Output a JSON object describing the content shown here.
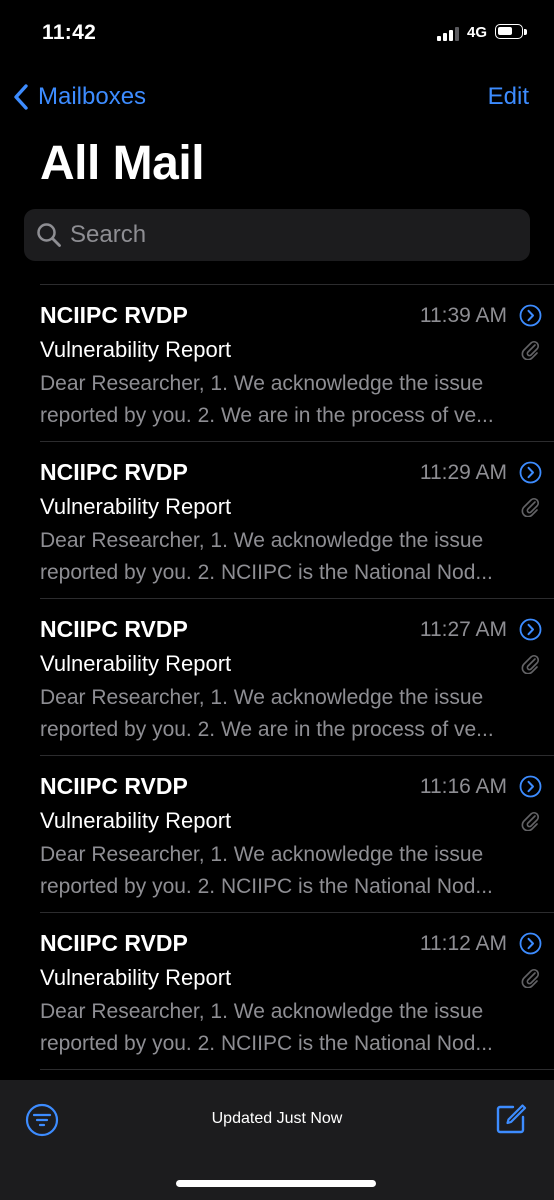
{
  "status_bar": {
    "time": "11:42",
    "network": "4G",
    "signal_icon": "signal-bars-icon",
    "battery_icon": "battery-icon",
    "battery_level": 0.5
  },
  "nav": {
    "back_label": "Mailboxes",
    "back_icon": "chevron-left-icon",
    "edit_label": "Edit"
  },
  "title": "All Mail",
  "search": {
    "placeholder": "Search",
    "value": "",
    "icon": "search-icon"
  },
  "emails": [
    {
      "sender": "NCIIPC RVDP",
      "time": "11:39 AM",
      "subject": "Vulnerability Report",
      "preview_line1": "Dear Researcher, 1. We acknowledge the issue",
      "preview_line2": "reported by you. 2. We are in the process of ve...",
      "has_attachment": true
    },
    {
      "sender": "NCIIPC RVDP",
      "time": "11:29 AM",
      "subject": "Vulnerability Report",
      "preview_line1": "Dear Researcher, 1. We acknowledge the issue",
      "preview_line2": "reported by you. 2. NCIIPC is the National Nod...",
      "has_attachment": true
    },
    {
      "sender": "NCIIPC RVDP",
      "time": "11:27 AM",
      "subject": "Vulnerability Report",
      "preview_line1": "Dear Researcher, 1. We acknowledge the issue",
      "preview_line2": "reported by you. 2. We are in the process of ve...",
      "has_attachment": true
    },
    {
      "sender": "NCIIPC RVDP",
      "time": "11:16 AM",
      "subject": "Vulnerability Report",
      "preview_line1": "Dear Researcher, 1. We acknowledge the issue",
      "preview_line2": "reported by you. 2. NCIIPC is the National Nod...",
      "has_attachment": true
    },
    {
      "sender": "NCIIPC RVDP",
      "time": "11:12 AM",
      "subject": "Vulnerability Report",
      "preview_line1": "Dear Researcher, 1. We acknowledge the issue",
      "preview_line2": "reported by you. 2. NCIIPC is the National Nod...",
      "has_attachment": true
    }
  ],
  "toolbar": {
    "status": "Updated Just Now",
    "filter_icon": "filter-icon",
    "compose_icon": "compose-icon"
  },
  "colors": {
    "accent": "#3d8cff",
    "background": "#000000",
    "secondary_text": "#8e8e93",
    "toolbar_bg": "#1c1c1e"
  }
}
